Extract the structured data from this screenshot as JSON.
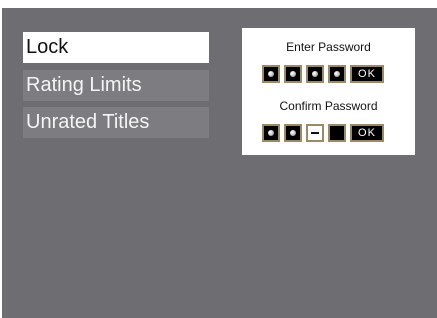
{
  "menu": {
    "items": [
      {
        "label": "Lock",
        "selected": true
      },
      {
        "label": "Rating Limits",
        "selected": false
      },
      {
        "label": "Unrated Titles",
        "selected": false
      }
    ]
  },
  "password_panel": {
    "enter_label": "Enter Password",
    "confirm_label": "Confirm Password",
    "ok_label": "OK",
    "enter_filled_digits": 4,
    "confirm_filled_digits": 2
  },
  "colors": {
    "screen_background": "#6e6e72",
    "menu_item_background": "#7d7d81",
    "selected_item_background": "#ffffff",
    "slot_border": "#9a8a66"
  }
}
